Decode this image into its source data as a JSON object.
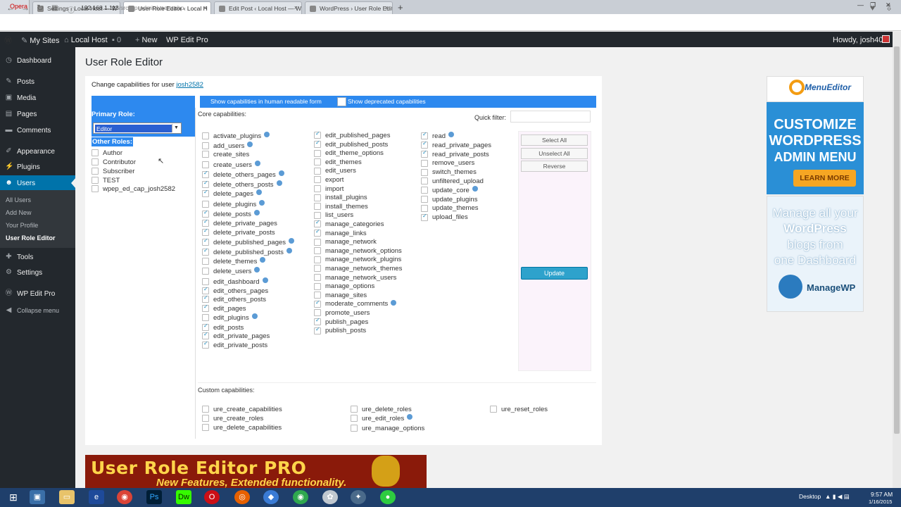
{
  "browser": {
    "opera_label": "Opera",
    "tabs": [
      {
        "label": "Settings ‹ Local Host — W"
      },
      {
        "label": "User Role Editor ‹ Local H"
      },
      {
        "label": "Edit Post ‹ Local Host — W"
      },
      {
        "label": "WordPress › User Role Edit"
      }
    ],
    "new_tab": "+",
    "url_host": "192.168.1.113",
    "url_path": "/src/wp-admin/users.php"
  },
  "adminbar": {
    "my_sites": "My Sites",
    "site": "Local Host",
    "comments": "0",
    "new": "New",
    "plugin": "WP Edit Pro",
    "howdy": "Howdy, josh401"
  },
  "sidebar": {
    "items": [
      {
        "label": "Dashboard"
      },
      {
        "label": "Posts"
      },
      {
        "label": "Media"
      },
      {
        "label": "Pages"
      },
      {
        "label": "Comments"
      },
      {
        "label": "Appearance"
      },
      {
        "label": "Plugins"
      },
      {
        "label": "Users"
      },
      {
        "label": "Tools"
      },
      {
        "label": "Settings"
      },
      {
        "label": "WP Edit Pro"
      },
      {
        "label": "Collapse menu"
      }
    ],
    "submenu": [
      "All Users",
      "Add New",
      "Your Profile",
      "User Role Editor"
    ]
  },
  "page": {
    "title": "User Role Editor",
    "change_text": "Change capabilities for user",
    "user_link": "josh2582",
    "show_human": "Show capabilities in human readable form",
    "show_deprecated": "Show deprecated capabilities",
    "primary_role_label": "Primary Role:",
    "primary_role_value": "Editor",
    "other_roles_label": "Other Roles:",
    "other_roles": [
      "Author",
      "Contributor",
      "Subscriber",
      "TEST",
      "wpep_ed_cap_josh2582"
    ],
    "core_label": "Core capabilities:",
    "quick_filter": "Quick filter:",
    "custom_label": "Custom capabilities:",
    "buttons": {
      "select_all": "Select All",
      "unselect_all": "Unselect All",
      "reverse": "Reverse",
      "update": "Update"
    }
  },
  "caps_col1": [
    {
      "name": "activate_plugins",
      "on": false,
      "q": true
    },
    {
      "name": "add_users",
      "on": false,
      "q": true
    },
    {
      "name": "create_sites",
      "on": false,
      "q": false
    },
    {
      "name": "create_users",
      "on": false,
      "q": true
    },
    {
      "name": "delete_others_pages",
      "on": true,
      "q": true
    },
    {
      "name": "delete_others_posts",
      "on": true,
      "q": true
    },
    {
      "name": "delete_pages",
      "on": true,
      "q": true
    },
    {
      "name": "delete_plugins",
      "on": false,
      "q": true
    },
    {
      "name": "delete_posts",
      "on": true,
      "q": true
    },
    {
      "name": "delete_private_pages",
      "on": true,
      "q": false
    },
    {
      "name": "delete_private_posts",
      "on": true,
      "q": false
    },
    {
      "name": "delete_published_pages",
      "on": true,
      "q": true
    },
    {
      "name": "delete_published_posts",
      "on": true,
      "q": true
    },
    {
      "name": "delete_themes",
      "on": false,
      "q": true
    },
    {
      "name": "delete_users",
      "on": false,
      "q": true
    },
    {
      "name": "edit_dashboard",
      "on": false,
      "q": true
    },
    {
      "name": "edit_others_pages",
      "on": true,
      "q": false
    },
    {
      "name": "edit_others_posts",
      "on": true,
      "q": false
    },
    {
      "name": "edit_pages",
      "on": true,
      "q": false
    },
    {
      "name": "edit_plugins",
      "on": false,
      "q": true
    },
    {
      "name": "edit_posts",
      "on": true,
      "q": false
    },
    {
      "name": "edit_private_pages",
      "on": true,
      "q": false
    },
    {
      "name": "edit_private_posts",
      "on": true,
      "q": false
    }
  ],
  "caps_col2": [
    {
      "name": "edit_published_pages",
      "on": true,
      "q": false
    },
    {
      "name": "edit_published_posts",
      "on": true,
      "q": false
    },
    {
      "name": "edit_theme_options",
      "on": false,
      "q": false
    },
    {
      "name": "edit_themes",
      "on": false,
      "q": false
    },
    {
      "name": "edit_users",
      "on": false,
      "q": false
    },
    {
      "name": "export",
      "on": false,
      "q": false
    },
    {
      "name": "import",
      "on": false,
      "q": false
    },
    {
      "name": "install_plugins",
      "on": false,
      "q": false
    },
    {
      "name": "install_themes",
      "on": false,
      "q": false
    },
    {
      "name": "list_users",
      "on": false,
      "q": false
    },
    {
      "name": "manage_categories",
      "on": true,
      "q": false
    },
    {
      "name": "manage_links",
      "on": true,
      "q": false
    },
    {
      "name": "manage_network",
      "on": false,
      "q": false
    },
    {
      "name": "manage_network_options",
      "on": false,
      "q": false
    },
    {
      "name": "manage_network_plugins",
      "on": false,
      "q": false
    },
    {
      "name": "manage_network_themes",
      "on": false,
      "q": false
    },
    {
      "name": "manage_network_users",
      "on": false,
      "q": false
    },
    {
      "name": "manage_options",
      "on": false,
      "q": false
    },
    {
      "name": "manage_sites",
      "on": false,
      "q": false
    },
    {
      "name": "moderate_comments",
      "on": true,
      "q": true
    },
    {
      "name": "promote_users",
      "on": false,
      "q": false
    },
    {
      "name": "publish_pages",
      "on": true,
      "q": false
    },
    {
      "name": "publish_posts",
      "on": true,
      "q": false
    }
  ],
  "caps_col3": [
    {
      "name": "read",
      "on": true,
      "q": true
    },
    {
      "name": "read_private_pages",
      "on": true,
      "q": false
    },
    {
      "name": "read_private_posts",
      "on": true,
      "q": false
    },
    {
      "name": "remove_users",
      "on": false,
      "q": false
    },
    {
      "name": "switch_themes",
      "on": false,
      "q": false
    },
    {
      "name": "unfiltered_upload",
      "on": false,
      "q": false
    },
    {
      "name": "update_core",
      "on": false,
      "q": true
    },
    {
      "name": "update_plugins",
      "on": false,
      "q": false
    },
    {
      "name": "update_themes",
      "on": false,
      "q": false
    },
    {
      "name": "upload_files",
      "on": true,
      "q": false
    }
  ],
  "custom_caps": [
    {
      "name": "ure_create_capabilities",
      "on": false,
      "q": false
    },
    {
      "name": "ure_create_roles",
      "on": false,
      "q": false
    },
    {
      "name": "ure_delete_capabilities",
      "on": false,
      "q": false
    },
    {
      "name": "ure_delete_roles",
      "on": false,
      "q": false
    },
    {
      "name": "ure_edit_roles",
      "on": false,
      "q": true
    },
    {
      "name": "ure_manage_options",
      "on": false,
      "q": false
    },
    {
      "name": "ure_reset_roles",
      "on": false,
      "q": false
    }
  ],
  "ads": {
    "ame_logo": "MenuEditor",
    "ame_lines": [
      "CUSTOMIZE",
      "WORDPRESS",
      "ADMIN MENU"
    ],
    "learn_more": "LEARN MORE",
    "mwp_lines": [
      "Manage all your",
      "WordPress",
      "blogs from",
      "one Dashboard"
    ],
    "mwp_logo": "ManageWP",
    "ure_title": "User Role Editor PRO",
    "ure_sub": "New Features, Extended functionality."
  },
  "taskbar": {
    "desktop": "Desktop",
    "time": "9:57 AM",
    "date": "1/16/2015"
  }
}
